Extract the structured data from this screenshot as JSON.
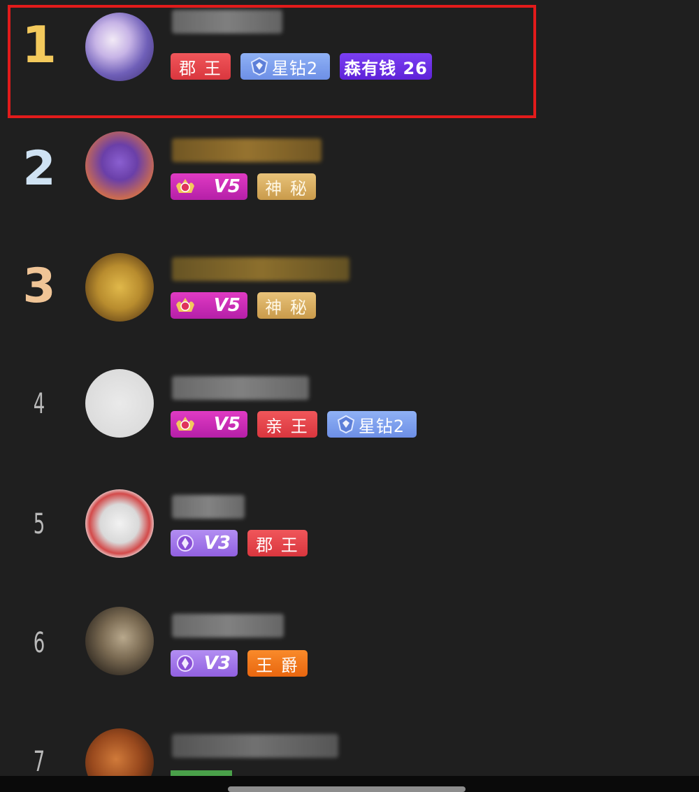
{
  "leaderboard": {
    "rows": [
      {
        "rank": "1",
        "badges": [
          {
            "type": "title",
            "label": "郡 王"
          },
          {
            "type": "blue-diamond",
            "label": "星钻2"
          },
          {
            "type": "purple",
            "label": "森有钱 26"
          }
        ]
      },
      {
        "rank": "2",
        "badges": [
          {
            "type": "vip",
            "label": "V5"
          },
          {
            "type": "mystery",
            "label": "神 秘"
          }
        ]
      },
      {
        "rank": "3",
        "badges": [
          {
            "type": "vip",
            "label": "V5"
          },
          {
            "type": "mystery",
            "label": "神 秘"
          }
        ]
      },
      {
        "rank": "4",
        "badges": [
          {
            "type": "vip",
            "label": "V5"
          },
          {
            "type": "title",
            "label": "亲 王"
          },
          {
            "type": "blue-diamond",
            "label": "星钻2"
          }
        ]
      },
      {
        "rank": "5",
        "badges": [
          {
            "type": "vip",
            "label": "V3"
          },
          {
            "type": "title",
            "label": "郡 王"
          }
        ]
      },
      {
        "rank": "6",
        "badges": [
          {
            "type": "vip",
            "label": "V3"
          },
          {
            "type": "title-orange",
            "label": "王 爵"
          }
        ]
      },
      {
        "rank": "7",
        "badges": []
      }
    ]
  },
  "colors": {
    "background": "#1f1f1f",
    "highlight": "#e21b1b",
    "rank1": "#f3c95c",
    "rank2": "#cfe2f3",
    "rank3": "#efc496"
  }
}
